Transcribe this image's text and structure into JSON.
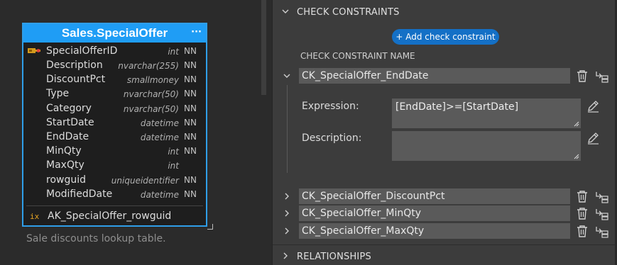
{
  "table": {
    "title": "Sales.SpecialOffer",
    "menu": "···",
    "columns": [
      {
        "name": "SpecialOfferID",
        "type": "int",
        "nn": "NN",
        "pk": true
      },
      {
        "name": "Description",
        "type": "nvarchar(255)",
        "nn": "NN"
      },
      {
        "name": "DiscountPct",
        "type": "smallmoney",
        "nn": "NN"
      },
      {
        "name": "Type",
        "type": "nvarchar(50)",
        "nn": "NN"
      },
      {
        "name": "Category",
        "type": "nvarchar(50)",
        "nn": "NN"
      },
      {
        "name": "StartDate",
        "type": "datetime",
        "nn": "NN"
      },
      {
        "name": "EndDate",
        "type": "datetime",
        "nn": "NN"
      },
      {
        "name": "MinQty",
        "type": "int",
        "nn": "NN"
      },
      {
        "name": "MaxQty",
        "type": "int",
        "nn": ""
      },
      {
        "name": "rowguid",
        "type": "uniqueidentifier",
        "nn": "NN"
      },
      {
        "name": "ModifiedDate",
        "type": "datetime",
        "nn": "NN"
      }
    ],
    "index": {
      "icon": "ix",
      "name": "AK_SpecialOffer_rowguid"
    },
    "description": "Sale discounts lookup table."
  },
  "panel": {
    "check_header": "CHECK CONSTRAINTS",
    "add_button": "+ Add check constraint",
    "name_column_label": "CHECK CONSTRAINT NAME",
    "expanded": {
      "name": "CK_SpecialOffer_EndDate",
      "expression_label": "Expression:",
      "expression": "[EndDate]>=[StartDate]",
      "description_label": "Description:",
      "description": ""
    },
    "collapsed": [
      {
        "name": "CK_SpecialOffer_DiscountPct"
      },
      {
        "name": "CK_SpecialOffer_MinQty"
      },
      {
        "name": "CK_SpecialOffer_MaxQty"
      }
    ],
    "relationships_header": "RELATIONSHIPS"
  },
  "icons": {
    "chevron_down": "chevron-down-icon",
    "chevron_right": "chevron-right-icon",
    "trash": "trash-icon",
    "reorder": "reorder-icon",
    "edit": "pencil-icon",
    "primary_key": "key-icon",
    "index": "index-icon"
  },
  "colors": {
    "accent": "#1f9df5",
    "button": "#1470c6",
    "panel_bg": "#3c3c3c",
    "field_bg": "#5a5a5a"
  }
}
